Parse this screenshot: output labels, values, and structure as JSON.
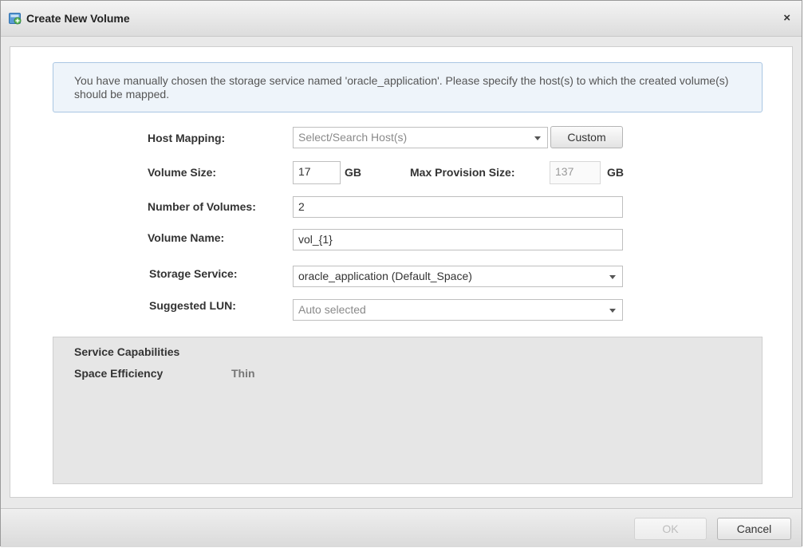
{
  "dialog": {
    "title": "Create New Volume",
    "icon": "add-volume-icon",
    "close_label": "×"
  },
  "info": {
    "message": "You have manually chosen the storage service named 'oracle_application'. Please specify the host(s) to which the created volume(s) should be mapped."
  },
  "form": {
    "host_mapping": {
      "label": "Host Mapping:",
      "placeholder": "Select/Search  Host(s)",
      "custom_button": "Custom"
    },
    "volume_size": {
      "label": "Volume Size:",
      "value": "17",
      "unit": "GB"
    },
    "max_provision": {
      "label": "Max Provision Size:",
      "value": "137",
      "unit": "GB"
    },
    "number_of_volumes": {
      "label": "Number of Volumes:",
      "value": "2"
    },
    "volume_name": {
      "label": "Volume Name:",
      "value": "vol_{1}"
    },
    "storage_service": {
      "label": "Storage Service:",
      "value": "oracle_application (Default_Space)"
    },
    "suggested_lun": {
      "label": "Suggested LUN:",
      "value": "Auto selected"
    }
  },
  "capabilities": {
    "title": "Service Capabilities",
    "space_efficiency_label": "Space Efficiency",
    "space_efficiency_value": "Thin"
  },
  "footer": {
    "ok_label": "OK",
    "cancel_label": "Cancel"
  },
  "colors": {
    "info_bg": "#eef4fa",
    "info_border": "#a9c6e3",
    "panel_bg": "#e6e6e6"
  }
}
